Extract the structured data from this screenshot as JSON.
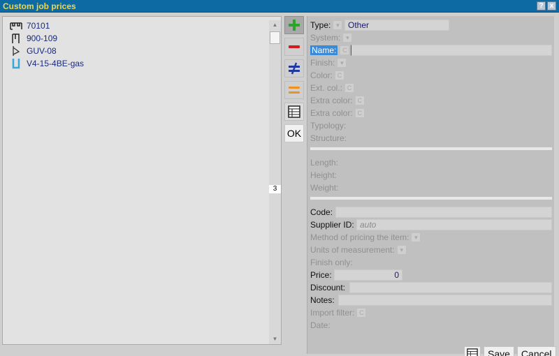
{
  "window": {
    "title": "Custom job prices"
  },
  "titlebar": {
    "help_label": "?",
    "close_label": "x"
  },
  "list": {
    "items": [
      {
        "label": "70101",
        "icon": "profile-icon"
      },
      {
        "label": "900-109",
        "icon": "gasket-icon"
      },
      {
        "label": "GUV-08",
        "icon": "clip-icon"
      },
      {
        "label": "V4-15-4BE-gas",
        "icon": "glass-icon"
      }
    ],
    "scroll_label": "3"
  },
  "toolbar": {
    "add_icon": "plus-icon",
    "remove_icon": "minus-icon",
    "replace_icon": "not-equal-icon",
    "equal_icon": "equal-icon",
    "table_icon": "table-icon",
    "ok_label": "OK"
  },
  "form": {
    "type_label": "Type:",
    "type_value": "Other",
    "system_label": "System:",
    "name_label": "Name:",
    "finish_label": "Finish:",
    "color_label": "Color:",
    "ext_col_label": "Ext. col.:",
    "extra_color_label": "Extra color:",
    "extra_color2_label": "Extra color:",
    "typology_label": "Typology:",
    "structure_label": "Structure:",
    "length_label": "Length:",
    "height_label": "Height:",
    "weight_label": "Weight:",
    "code_label": "Code:",
    "supplier_label": "Supplier ID:",
    "supplier_placeholder": "auto",
    "method_label": "Method of pricing the item:",
    "units_label": "Units of measurement:",
    "finish_only_label": "Finish only:",
    "price_label": "Price:",
    "price_value": "0",
    "discount_label": "Discount:",
    "notes_label": "Notes:",
    "import_filter_label": "Import filter:",
    "date_label": "Date:",
    "mini_c": "C"
  },
  "footer": {
    "save_label": "Save",
    "cancel_label": "Cancel"
  },
  "colors": {
    "titlebar": "#0e6aa3",
    "title_text": "#f2d64a",
    "highlight": "#3a8ad6",
    "plus": "#2aa52a",
    "minus": "#d41c1c",
    "notequal": "#1e3aa0",
    "equal": "#f0901e"
  }
}
